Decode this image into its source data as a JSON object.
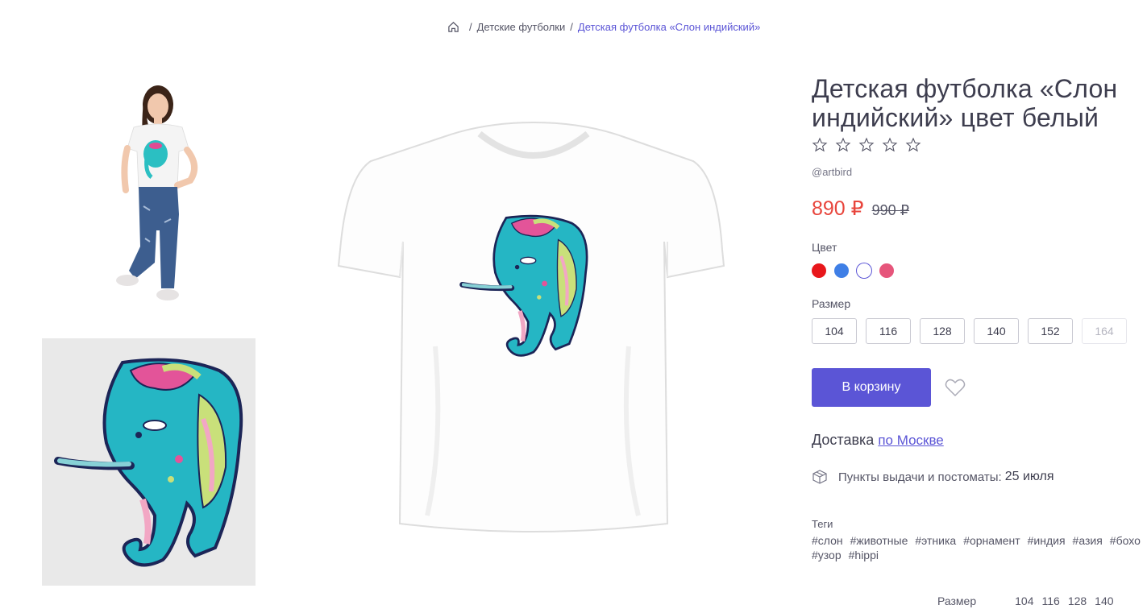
{
  "breadcrumb": {
    "home_icon": "home-icon",
    "items": [
      "Детские футболки",
      "Детская футболка «Слон индийский»"
    ]
  },
  "product": {
    "title": "Детская футболка «Слон индийский» цвет белый",
    "rating_stars": 5,
    "author": "@artbird",
    "price_now": "890 ₽",
    "price_old": "990 ₽",
    "color_label": "Цвет",
    "colors": [
      "#e8171b",
      "#3f7fe6",
      "#ffffff",
      "#e6557b"
    ],
    "selected_color_index": 2,
    "size_label": "Размер",
    "sizes": [
      "104",
      "116",
      "128",
      "140",
      "152",
      "164"
    ],
    "disabled_sizes": [
      "164"
    ],
    "cart_button": "В корзину",
    "favorite_icon": "heart-icon"
  },
  "delivery": {
    "label": "Доставка",
    "link": "по Москве",
    "pickup_icon": "box-icon",
    "pickup_text": "Пункты выдачи и постоматы:",
    "pickup_date": "25 июля"
  },
  "tags": {
    "label": "Теги",
    "items": [
      "#слон",
      "#животные",
      "#этника",
      "#орнамент",
      "#индия",
      "#азия",
      "#бохо",
      "#узор",
      "#hippi"
    ]
  },
  "size_table": {
    "label": "Размер",
    "values": [
      "104",
      "116",
      "128",
      "140"
    ]
  },
  "accent": "#5b55d6",
  "price_color": "#e8453c"
}
